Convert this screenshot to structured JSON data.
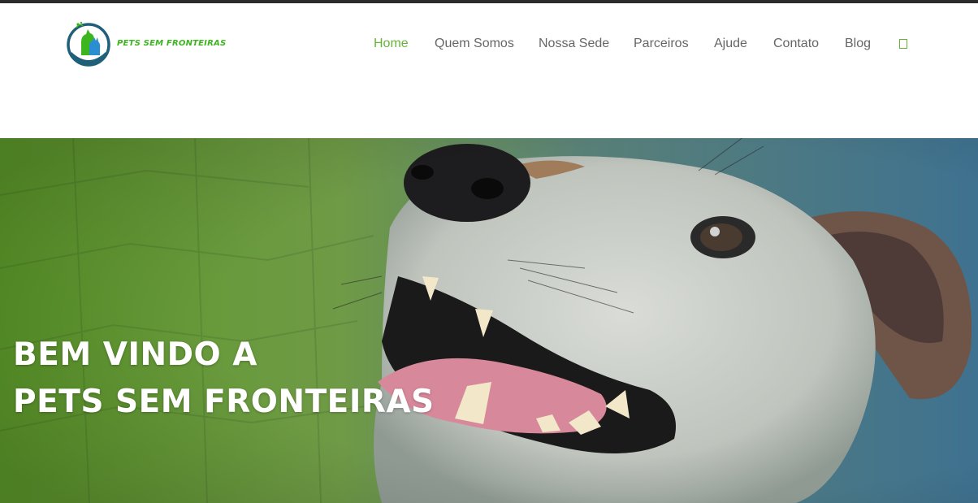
{
  "header": {
    "logo_text": "PETS SEM FRONTEIRAS",
    "logo_icon": "dog-and-cat-logo-icon"
  },
  "nav": {
    "items": [
      {
        "label": "Home",
        "active": true
      },
      {
        "label": "Quem Somos",
        "active": false
      },
      {
        "label": "Nossa Sede",
        "active": false
      },
      {
        "label": "Parceiros",
        "active": false
      },
      {
        "label": "Ajude",
        "active": false
      },
      {
        "label": "Contato",
        "active": false
      },
      {
        "label": "Blog",
        "active": false
      }
    ],
    "search_icon": "search-icon"
  },
  "hero": {
    "title_line1": "BEM VINDO A",
    "title_line2": "PETS SEM FRONTEIRAS",
    "image": "smiling-dog-photo"
  },
  "colors": {
    "accent_green": "#68b43a",
    "logo_green": "#3cb51e",
    "nav_text": "#666666",
    "top_bar": "#2b2b2b",
    "hero_overlay_left": "#5d9a2a",
    "hero_overlay_right": "#3f7290"
  }
}
